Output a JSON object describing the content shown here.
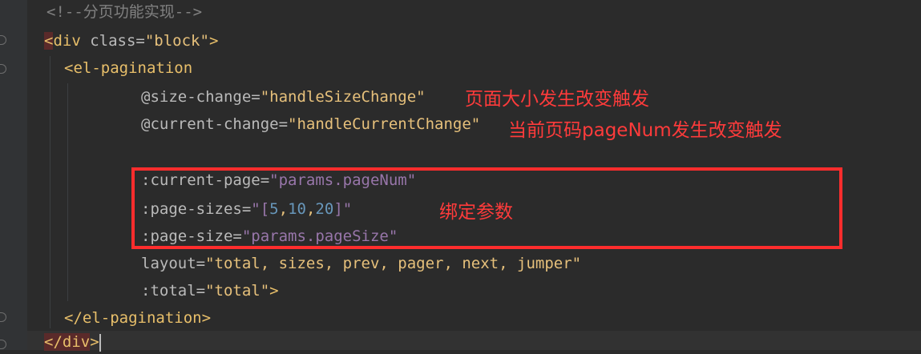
{
  "colors": {
    "background": "#2b2b2b",
    "annotation_red": "#ff3b3b"
  },
  "code": {
    "line1_comment": "<!--分页功能实现-->",
    "line2_open_lt": "<",
    "line2_tag": "div",
    "line2_attr": " class=",
    "line2_value": "\"block\"",
    "line2_gt": ">",
    "line3_open_lt": "<",
    "line3_tag": "el-pagination",
    "line4_attr": "@size-change=",
    "line4_value": "\"handleSizeChange\"",
    "line5_attr": "@current-change=",
    "line5_value": "\"handleCurrentChange\"",
    "line7_attr": ":current-page=",
    "line7_value": "\"params.pageNum\"",
    "line8_attr": ":page-sizes=",
    "line8_q1": "\"[",
    "line8_n1": "5",
    "line8_c1": ",",
    "line8_n2": "10",
    "line8_c2": ",",
    "line8_n3": "20",
    "line8_q2": "]\"",
    "line9_attr": ":page-size=",
    "line9_value": "\"params.pageSize\"",
    "line10_attr": "layout=",
    "line10_value": "\"total, sizes, prev, pager, next, jumper\"",
    "line11_attr": ":total=",
    "line11_value": "\"total\"",
    "line11_gt": ">",
    "line12_close": "</",
    "line12_tag": "el-pagination",
    "line12_gt": ">",
    "line13_close": "</",
    "line13_tag": "div",
    "line13_gt": ">"
  },
  "annotations": {
    "size_change": "页面大小发生改变触发",
    "current_change": "当前页码pageNum发生改变触发",
    "bind_params": "绑定参数"
  }
}
